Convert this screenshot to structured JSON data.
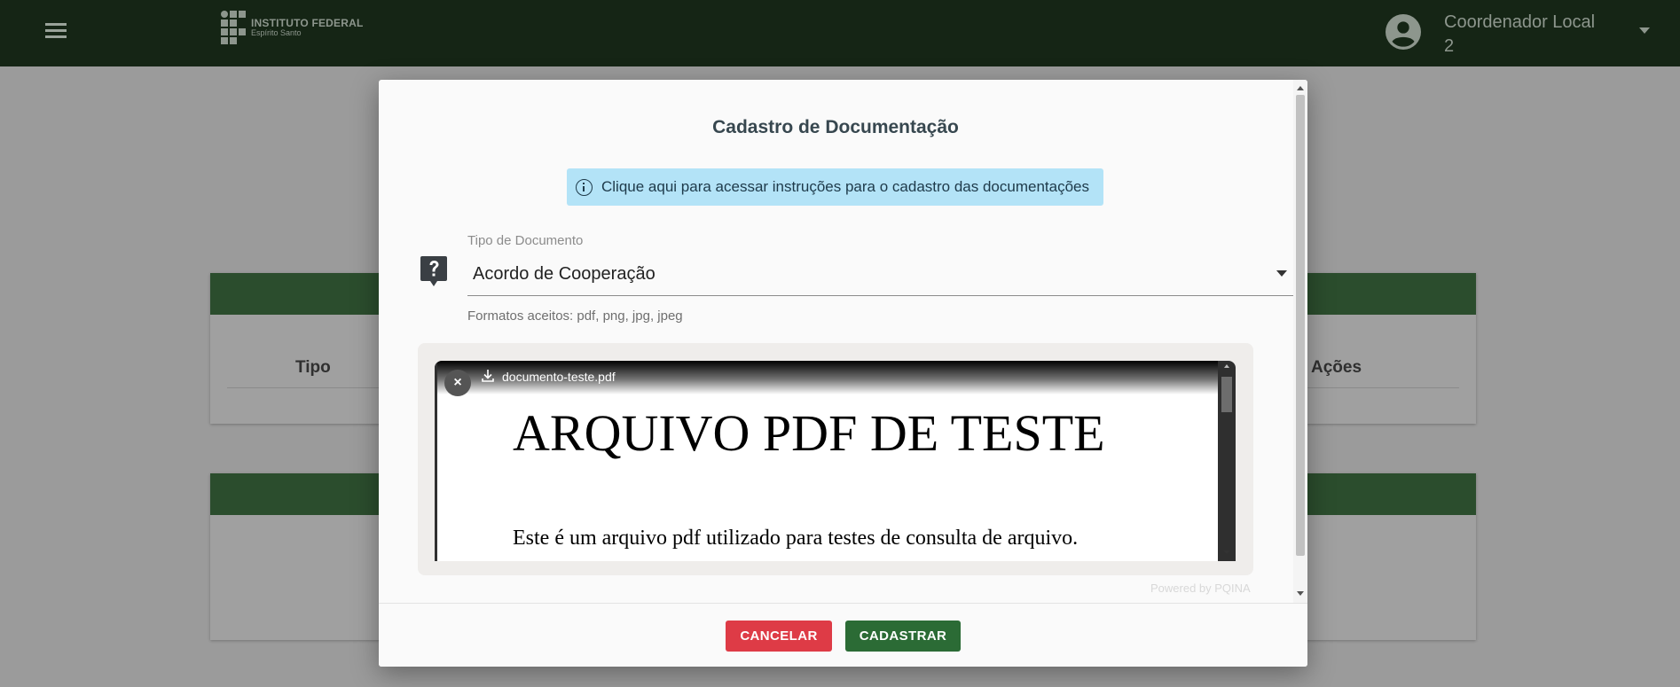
{
  "header": {
    "menu_icon": "hamburger-menu-icon",
    "logo": {
      "title": "INSTITUTO FEDERAL",
      "subtitle": "Espírito Santo"
    },
    "user": {
      "name": "Coordenador Local 2",
      "avatar_icon": "account-circle-icon",
      "menu_icon": "caret-down-icon"
    }
  },
  "background": {
    "table_columns": [
      "Tipo",
      "Ações"
    ]
  },
  "modal": {
    "title": "Cadastro de Documentação",
    "info": {
      "icon": "info-circle-icon",
      "text": "Clique aqui para acessar instruções para o cadastro das documentações"
    },
    "document_type": {
      "icon": "question-bubble-icon",
      "label": "Tipo de Documento",
      "value": "Acordo de Cooperação",
      "hint": "Formatos aceitos: pdf, png, jpg, jpeg"
    },
    "upload": {
      "file_name": "documento-teste.pdf",
      "remove_label": "×",
      "preview_title": "ARQUIVO PDF DE TESTE",
      "preview_body": "Este é um arquivo pdf utilizado para testes de consulta de arquivo.",
      "credit": "Powered by PQINA"
    },
    "actions": {
      "cancel": "CANCELAR",
      "submit": "CADASTRAR"
    }
  },
  "colors": {
    "header_bg": "#152515",
    "accent_green": "#2b6b35",
    "cancel_red": "#de3b46",
    "info_bg": "#b3e3f7"
  }
}
